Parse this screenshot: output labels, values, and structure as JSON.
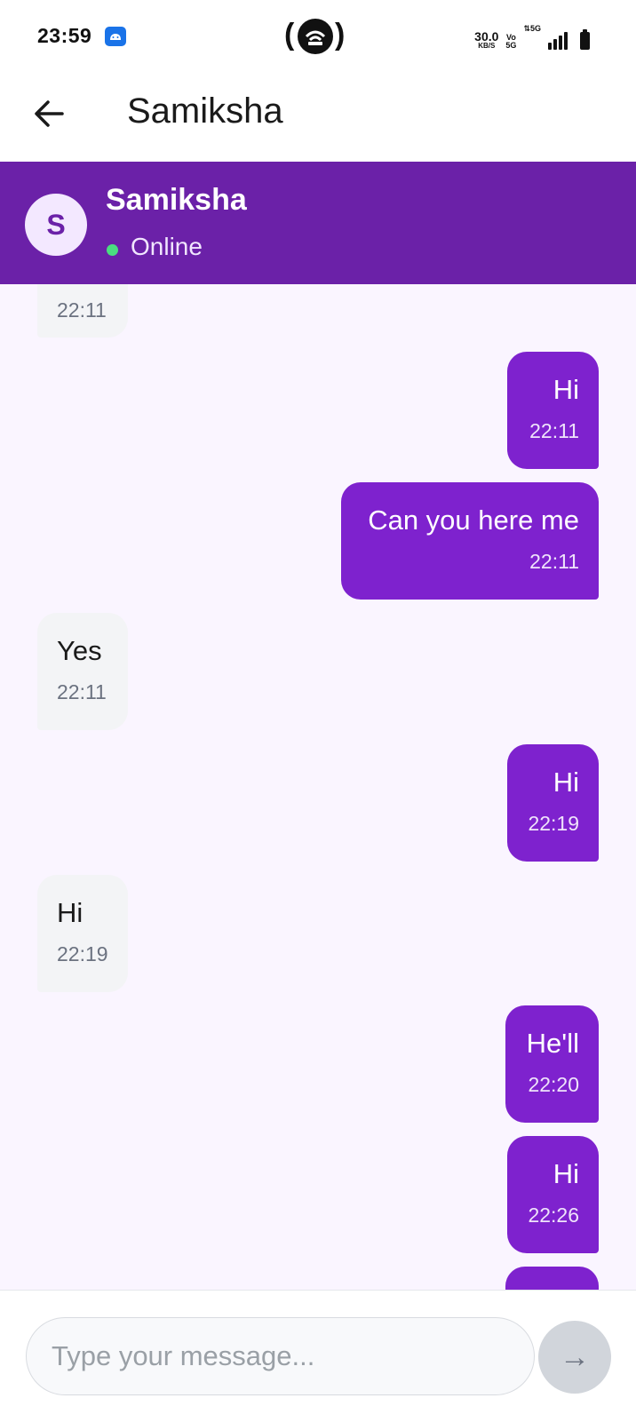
{
  "status_bar": {
    "time": "23:59",
    "net_speed_value": "30.0",
    "net_speed_unit": "KB/S",
    "volte_top": "Vo",
    "volte_bottom": "5G",
    "network_type": "5G",
    "signal_level": 4,
    "battery_level": 1.0
  },
  "app_bar": {
    "title": "Samiksha",
    "back_icon": "arrow-left-icon"
  },
  "contact": {
    "initial": "S",
    "name": "Samiksha",
    "status": "Online",
    "status_color": "#4ade80",
    "header_color": "#6b21a8"
  },
  "messages": [
    {
      "direction": "in",
      "text": "",
      "time": "22:11"
    },
    {
      "direction": "out",
      "text": "Hi",
      "time": "22:11"
    },
    {
      "direction": "out",
      "text": "Can you here me",
      "time": "22:11"
    },
    {
      "direction": "in",
      "text": "Yes",
      "time": "22:11"
    },
    {
      "direction": "out",
      "text": "Hi",
      "time": "22:19"
    },
    {
      "direction": "in",
      "text": "Hi",
      "time": "22:19"
    },
    {
      "direction": "out",
      "text": "He'll",
      "time": "22:20"
    },
    {
      "direction": "out",
      "text": "Hi",
      "time": "22:26"
    },
    {
      "direction": "out",
      "text": "",
      "time": ""
    }
  ],
  "composer": {
    "placeholder": "Type your message...",
    "value": "",
    "send_icon": "arrow-right-icon",
    "send_label": "→"
  },
  "colors": {
    "outgoing_bubble": "#7e22ce",
    "incoming_bubble": "#f3f4f6",
    "chat_background": "#faf5ff"
  }
}
